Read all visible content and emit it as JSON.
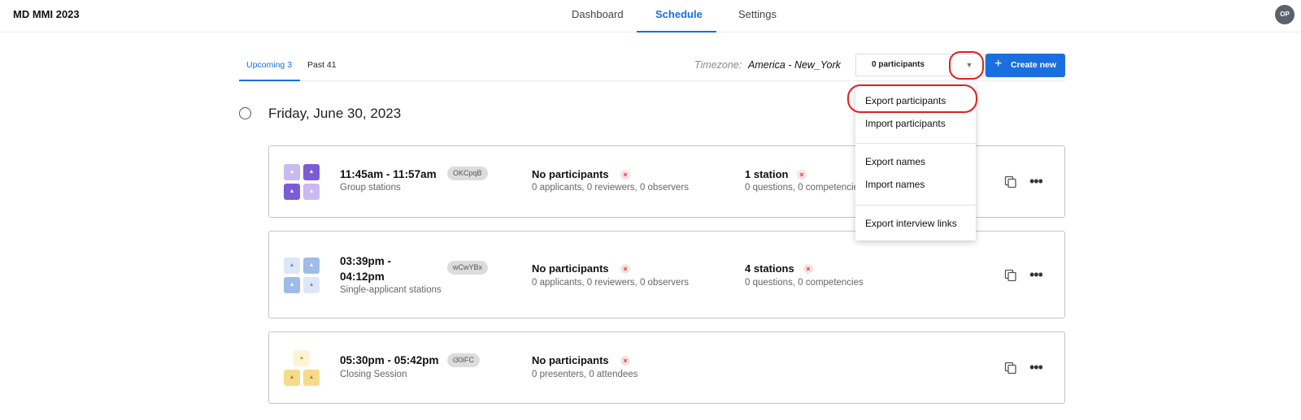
{
  "app": {
    "title": "MD MMI 2023",
    "avatar_initials": "OP"
  },
  "nav": {
    "tabs": [
      {
        "label": "Dashboard"
      },
      {
        "label": "Schedule"
      },
      {
        "label": "Settings"
      }
    ],
    "active": "Schedule"
  },
  "subtabs": [
    {
      "label": "Upcoming 3"
    },
    {
      "label": "Past 41"
    }
  ],
  "toolbar": {
    "timezone_label": "Timezone:",
    "timezone_value": "America - New_York",
    "participants_select": "0 participants",
    "create_label": "Create new"
  },
  "day": {
    "title": "Friday, June 30, 2023"
  },
  "sessions": [
    {
      "time": "11:45am - 11:57am",
      "kind": "Group stations",
      "code": "OKCpqB",
      "participants_title": "No participants",
      "participants_sub": "0 applicants, 0 reviewers, 0 observers",
      "stations_title": "1 station",
      "stations_sub": "0 questions, 0 competencies",
      "thumb_color": "#7b5cd6"
    },
    {
      "time": "03:39pm - 04:12pm",
      "kind": "Single-applicant stations",
      "code": "wCwYBx",
      "participants_title": "No participants",
      "participants_sub": "0 applicants, 0 reviewers, 0 observers",
      "stations_title": "4 stations",
      "stations_sub": "0 questions, 0 competencies",
      "thumb_color": "#9fbce8"
    },
    {
      "time": "05:30pm - 05:42pm",
      "kind": "Closing Session",
      "code": "i30iFC",
      "participants_title": "No participants",
      "participants_sub": "0 presenters, 0 attendees",
      "thumb_color": "#f6dc8a"
    }
  ],
  "menu": {
    "items": [
      {
        "label": "Export participants"
      },
      {
        "label": "Import participants"
      },
      {
        "label": "Export names"
      },
      {
        "label": "Import names"
      },
      {
        "label": "Export interview links"
      }
    ]
  },
  "colors": {
    "accent": "#1a6fe0",
    "highlight_ring": "#e02020",
    "error": "#e23030"
  }
}
